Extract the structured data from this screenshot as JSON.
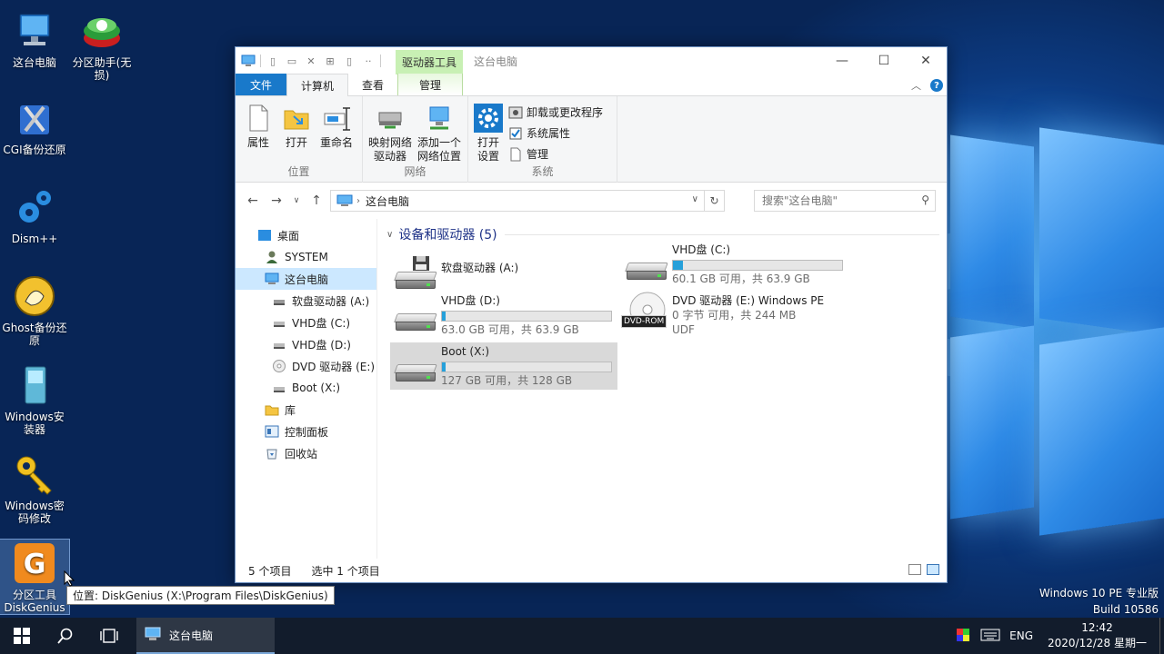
{
  "desktop": {
    "icons": [
      {
        "label": "这台电脑"
      },
      {
        "label": "分区助手(无损)"
      },
      {
        "label": "CGI备份还原"
      },
      {
        "label": "Dism++"
      },
      {
        "label": "Ghost备份还原"
      },
      {
        "label": "Windows安装器"
      },
      {
        "label": "Windows密码修改"
      },
      {
        "label": "分区工具DiskGenius"
      }
    ],
    "tooltip": "位置: DiskGenius (X:\\Program Files\\DiskGenius)"
  },
  "window": {
    "context_tab": "驱动器工具",
    "title": "这台电脑",
    "tabs": {
      "file": "文件",
      "computer": "计算机",
      "view": "查看",
      "manage": "管理"
    },
    "ribbon": {
      "location": {
        "name": "位置",
        "properties": "属性",
        "open": "打开",
        "rename": "重命名"
      },
      "network": {
        "name": "网络",
        "map_drive": "映射网络驱动器",
        "add_location": "添加一个网络位置"
      },
      "system": {
        "name": "系统",
        "open_settings": "打开设置",
        "uninstall": "卸载或更改程序",
        "sys_props": "系统属性",
        "manage": "管理"
      }
    },
    "address": {
      "crumb": "这台电脑",
      "search_placeholder": "搜索\"这台电脑\""
    },
    "nav": [
      {
        "label": "桌面"
      },
      {
        "label": "SYSTEM"
      },
      {
        "label": "这台电脑"
      },
      {
        "label": "软盘驱动器 (A:)"
      },
      {
        "label": "VHD盘 (C:)"
      },
      {
        "label": "VHD盘 (D:)"
      },
      {
        "label": "DVD 驱动器 (E:) W"
      },
      {
        "label": "Boot (X:)"
      },
      {
        "label": "库"
      },
      {
        "label": "控制面板"
      },
      {
        "label": "回收站"
      }
    ],
    "group_title": "设备和驱动器 (5)",
    "drives": [
      {
        "name": "软盘驱动器 (A:)",
        "free": "",
        "used_fraction": null
      },
      {
        "name": "VHD盘 (C:)",
        "free": "60.1 GB 可用，共 63.9 GB",
        "used_fraction": 0.06
      },
      {
        "name": "VHD盘 (D:)",
        "free": "63.0 GB 可用，共 63.9 GB",
        "used_fraction": 0.014
      },
      {
        "name": "DVD 驱动器 (E:) Windows PE",
        "free": "0 字节 可用，共 244 MB",
        "fs": "UDF",
        "badge": "DVD-ROM"
      },
      {
        "name": "Boot (X:)",
        "free": "127 GB 可用，共 128 GB",
        "used_fraction": 0.008
      }
    ],
    "status": {
      "count": "5 个项目",
      "selected": "选中 1 个项目"
    }
  },
  "taskbar": {
    "app_label": "这台电脑",
    "lang": "ENG",
    "time": "12:42",
    "date": "2020/12/28 星期一"
  },
  "watermark": {
    "line1": "Windows 10 PE 专业版",
    "line2": "Build 10586"
  },
  "colors": {
    "accent": "#1979ca",
    "context_tab": "#c8f0b4",
    "bar_fill": "#26a0da",
    "selection": "#cce8ff"
  }
}
